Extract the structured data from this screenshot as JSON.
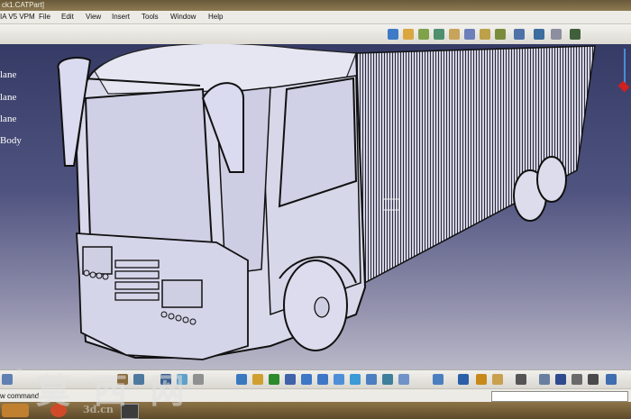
{
  "window": {
    "title": "ck1.CATPart]"
  },
  "menu": {
    "app_prefix": "IA V5 VPM",
    "items": [
      "File",
      "Edit",
      "View",
      "Insert",
      "Tools",
      "Window",
      "Help"
    ]
  },
  "tree": {
    "items": [
      "lane",
      "lane",
      "lane",
      "Body"
    ]
  },
  "status": {
    "message": "w command"
  },
  "watermark": {
    "text": "莫 西 网",
    "url": "3d.cn"
  },
  "taskbar": {
    "chevron": "»"
  },
  "colors": {
    "viewport_top": "#363b66",
    "viewport_bottom": "#b9b8c8",
    "truck_body": "#d9d9ec"
  }
}
